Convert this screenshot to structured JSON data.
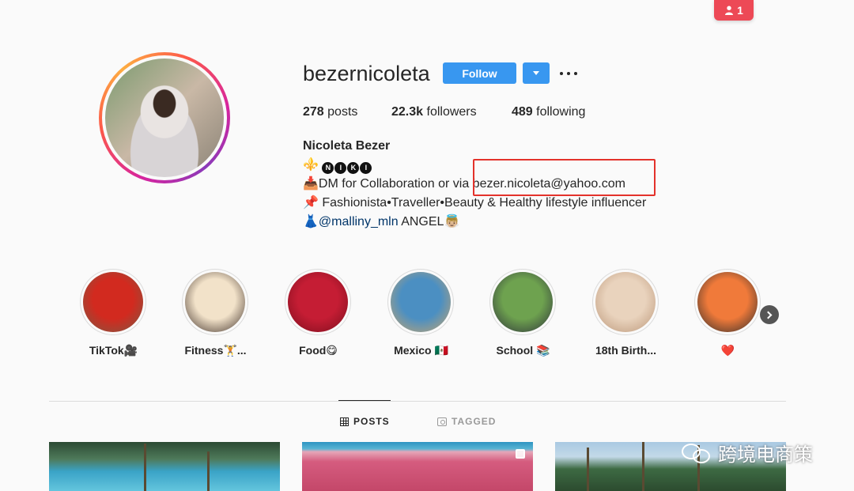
{
  "notification": {
    "count": "1"
  },
  "profile": {
    "username": "bezernicoleta",
    "follow_label": "Follow",
    "stats": [
      {
        "value": "278",
        "label": "posts"
      },
      {
        "value": "22.3k",
        "label": "followers"
      },
      {
        "value": "489",
        "label": "following"
      }
    ],
    "full_name": "Nicoleta Bezer",
    "bio": {
      "line1_icon": "⚜️",
      "line1_letters": [
        "N",
        "I",
        "K",
        "I"
      ],
      "line2_icon": "📥",
      "line2_text": "DM for Collaboration or via ",
      "email": "bezer.nicoleta@yahoo.com",
      "line3_icon": "📌",
      "line3_text": " Fashionista•Traveller•Beauty & Healthy lifestyle influencer",
      "line4_icon": "👗",
      "line4_mention": "@malliny_mln",
      "line4_text": " ANGEL👼🏼"
    }
  },
  "highlights": [
    {
      "label": "TikTok🎥",
      "colors": [
        "#d22a1f",
        "#7b5a44"
      ]
    },
    {
      "label": "Fitness🏋...",
      "colors": [
        "#f2e2c9",
        "#3a2b24"
      ]
    },
    {
      "label": "Food😋",
      "colors": [
        "#c51d34",
        "#7a0e1d"
      ]
    },
    {
      "label": "Mexico 🇲🇽",
      "colors": [
        "#4b8fc2",
        "#c9a56c"
      ]
    },
    {
      "label": "School 📚",
      "colors": [
        "#6ea24f",
        "#2b2f3a"
      ]
    },
    {
      "label": "18th Birth...",
      "colors": [
        "#e9d3bd",
        "#b99476"
      ]
    },
    {
      "label": "❤️",
      "colors": [
        "#f07a3a",
        "#2a2a2a"
      ]
    }
  ],
  "tabs": [
    {
      "label": "POSTS",
      "icon": "grid-icon",
      "active": true
    },
    {
      "label": "TAGGED",
      "icon": "tag-icon",
      "active": false
    }
  ],
  "watermark": {
    "text": "跨境电商策"
  },
  "colors": {
    "accent": "#3897f0",
    "notification": "#ed4956",
    "highlight_box": "#e3322b",
    "mention": "#003569"
  }
}
